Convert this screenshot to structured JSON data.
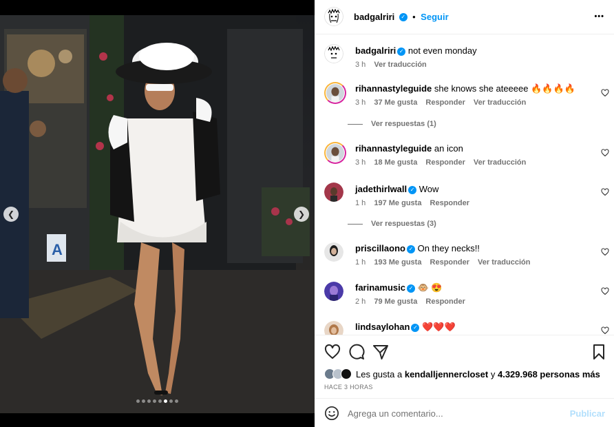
{
  "post": {
    "author": "badgalriri",
    "follow_label": "Seguir",
    "separator": "•",
    "more_label": "•••"
  },
  "caption": {
    "author": "badgalriri",
    "text": "not even monday",
    "time": "3 h",
    "translate": "Ver traducción"
  },
  "comments": [
    {
      "author": "rihannastyleguide",
      "text": "she knows she ateeeee 🔥🔥🔥🔥",
      "time": "3 h",
      "likes": "37 Me gusta",
      "reply": "Responder",
      "translate": "Ver traducción",
      "verified": false,
      "replies": "Ver respuestas (1)"
    },
    {
      "author": "rihannastyleguide",
      "text": "an icon",
      "time": "3 h",
      "likes": "18 Me gusta",
      "reply": "Responder",
      "translate": "Ver traducción",
      "verified": false
    },
    {
      "author": "jadethirlwall",
      "text": "Wow",
      "time": "1 h",
      "likes": "197 Me gusta",
      "reply": "Responder",
      "verified": true,
      "replies": "Ver respuestas (3)"
    },
    {
      "author": "priscillaono",
      "text": "On they necks!!",
      "time": "1 h",
      "likes": "193 Me gusta",
      "reply": "Responder",
      "translate": "Ver traducción",
      "verified": true
    },
    {
      "author": "farinamusic",
      "text": "🐵 😍",
      "time": "2 h",
      "likes": "79 Me gusta",
      "reply": "Responder",
      "verified": true
    },
    {
      "author": "lindsaylohan",
      "text": "❤️❤️❤️",
      "verified": true
    }
  ],
  "likes": {
    "prefix": "Les gusta a",
    "user": "kendalljennercloset",
    "joiner": "y",
    "count": "4.329.968 personas más",
    "time_ago": "HACE 3 HORAS"
  },
  "composer": {
    "placeholder": "Agrega un comentario...",
    "post_label": "Publicar"
  },
  "carousel": {
    "total": 8,
    "active_index": 5
  },
  "icons": {
    "prev": "chevron-left-icon",
    "next": "chevron-right-icon",
    "like": "heart-icon",
    "comment": "comment-icon",
    "share": "paper-plane-icon",
    "save": "bookmark-icon",
    "emoji": "smiley-icon"
  },
  "colors": {
    "accent": "#0095f6",
    "muted": "#737373",
    "divider": "#efefef",
    "post_disabled": "#b2dffc"
  }
}
